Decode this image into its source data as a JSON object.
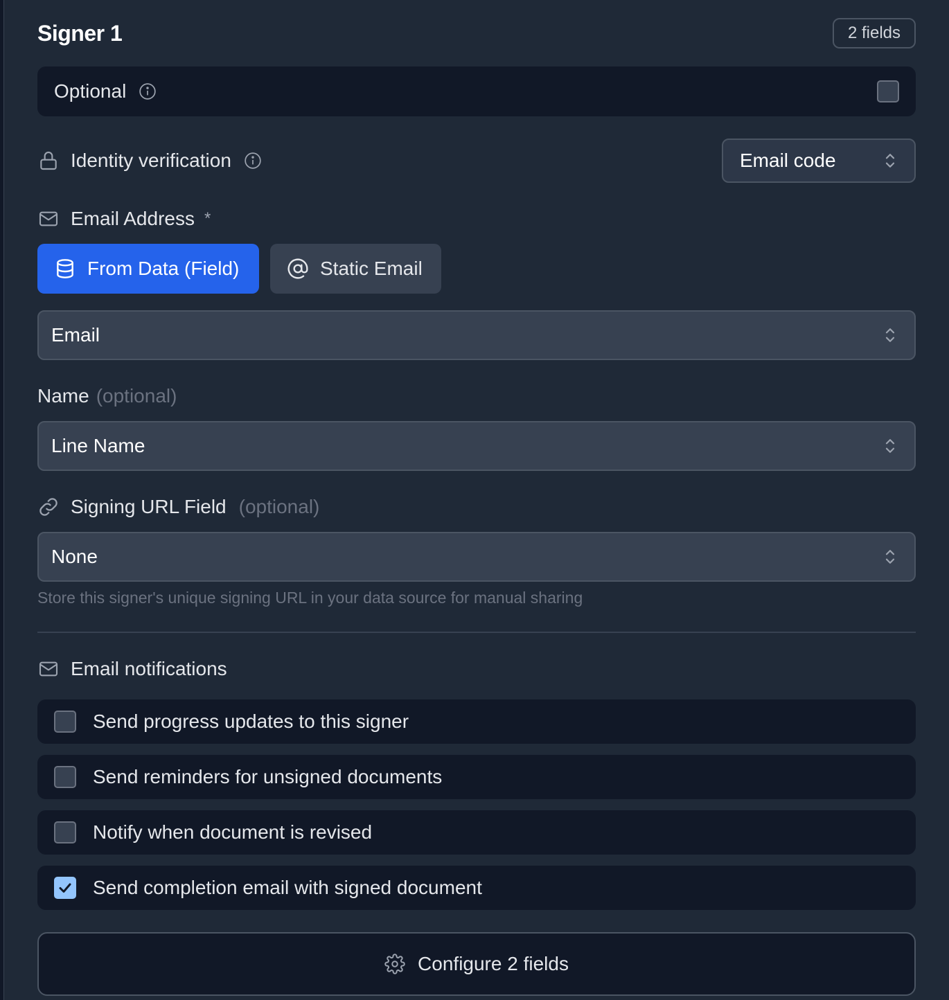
{
  "signer": {
    "title": "Signer 1",
    "fields_badge": "2 fields"
  },
  "optional": {
    "label": "Optional",
    "checked": false
  },
  "identity_verification": {
    "label": "Identity verification",
    "selected": "Email code"
  },
  "email_address": {
    "label": "Email Address",
    "required_mark": "*",
    "modes": [
      {
        "label": "From Data (Field)",
        "active": true,
        "icon": "database-icon"
      },
      {
        "label": "Static Email",
        "active": false,
        "icon": "at-sign-icon"
      }
    ],
    "selected_field": "Email"
  },
  "name": {
    "label": "Name",
    "optional_note": "(optional)",
    "selected_field": "Line Name"
  },
  "signing_url": {
    "label": "Signing URL Field",
    "optional_note": "(optional)",
    "selected_field": "None",
    "hint": "Store this signer's unique signing URL in your data source for manual sharing"
  },
  "email_notifications": {
    "title": "Email notifications",
    "items": [
      {
        "label": "Send progress updates to this signer",
        "checked": false
      },
      {
        "label": "Send reminders for unsigned documents",
        "checked": false
      },
      {
        "label": "Notify when document is revised",
        "checked": false
      },
      {
        "label": "Send completion email with signed document",
        "checked": true
      }
    ]
  },
  "configure_button": {
    "label": "Configure 2 fields"
  },
  "colors": {
    "background": "#1f2937",
    "card": "#111827",
    "accent": "#2563eb",
    "checkbox_checked": "#93c5fd"
  }
}
